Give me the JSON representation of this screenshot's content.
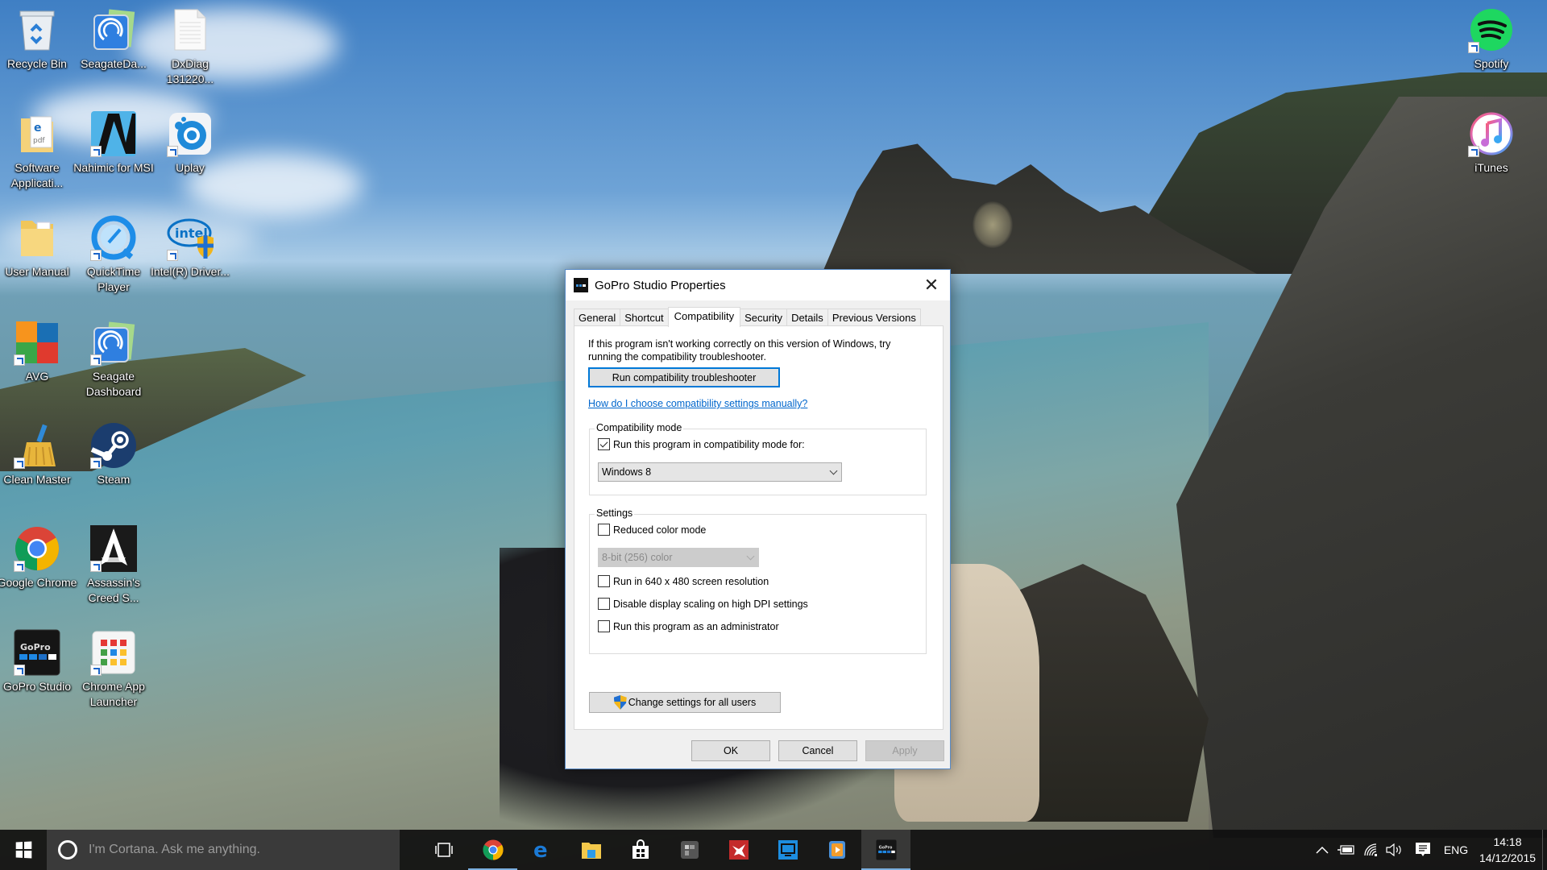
{
  "desktop": {
    "icons": [
      {
        "label": "Recycle Bin",
        "icon": "recycle-bin-icon",
        "shortcut": false
      },
      {
        "label": "SeagateDa...",
        "icon": "seagate-icon",
        "shortcut": false
      },
      {
        "label": "DxDiag 131220...",
        "icon": "text-file-icon",
        "shortcut": false
      },
      {
        "label": "Software Applicati...",
        "icon": "folder-pdf-icon",
        "shortcut": false
      },
      {
        "label": "Nahimic for MSI",
        "icon": "nahimic-icon",
        "shortcut": true
      },
      {
        "label": "Uplay",
        "icon": "uplay-icon",
        "shortcut": true
      },
      {
        "label": "User Manual",
        "icon": "folder-icon",
        "shortcut": false
      },
      {
        "label": "QuickTime Player",
        "icon": "quicktime-icon",
        "shortcut": true
      },
      {
        "label": "Intel(R) Driver...",
        "icon": "intel-icon",
        "shortcut": true
      },
      {
        "label": "AVG",
        "icon": "avg-icon",
        "shortcut": true
      },
      {
        "label": "Seagate Dashboard",
        "icon": "seagate-icon",
        "shortcut": true
      },
      {
        "label": "Clean Master",
        "icon": "broom-icon",
        "shortcut": true
      },
      {
        "label": "Steam",
        "icon": "steam-icon",
        "shortcut": true
      },
      {
        "label": "Google Chrome",
        "icon": "chrome-icon",
        "shortcut": true
      },
      {
        "label": "Assassin's Creed S...",
        "icon": "assassins-creed-icon",
        "shortcut": true
      },
      {
        "label": "GoPro Studio",
        "icon": "gopro-icon",
        "shortcut": true
      },
      {
        "label": "Chrome App Launcher",
        "icon": "app-launcher-icon",
        "shortcut": true
      },
      {
        "label": "Spotify",
        "icon": "spotify-icon",
        "shortcut": true
      },
      {
        "label": "iTunes",
        "icon": "itunes-icon",
        "shortcut": true
      }
    ]
  },
  "dialog": {
    "title": "GoPro Studio Properties",
    "close_glyph": "✕",
    "tabs": [
      {
        "label": "General",
        "active": false
      },
      {
        "label": "Shortcut",
        "active": false
      },
      {
        "label": "Compatibility",
        "active": true
      },
      {
        "label": "Security",
        "active": false
      },
      {
        "label": "Details",
        "active": false
      },
      {
        "label": "Previous Versions",
        "active": false
      }
    ],
    "intro_text": "If this program isn't working correctly on this version of Windows, try running the compatibility troubleshooter.",
    "troubleshooter_button": "Run compatibility troubleshooter",
    "help_link": "How do I choose compatibility settings manually?",
    "compat_group": {
      "title": "Compatibility mode",
      "checkbox_label": "Run this program in compatibility mode for:",
      "checked": true,
      "selected_os": "Windows 8"
    },
    "settings_group": {
      "title": "Settings",
      "reduced_color": {
        "label": "Reduced color mode",
        "checked": false
      },
      "color_select": "8-bit (256) color",
      "options": [
        {
          "label": "Run in 640 x 480 screen resolution",
          "checked": false
        },
        {
          "label": "Disable display scaling on high DPI settings",
          "checked": false
        },
        {
          "label": "Run this program as an administrator",
          "checked": false
        }
      ]
    },
    "all_users_button": "Change settings for all users",
    "ok_button": "OK",
    "cancel_button": "Cancel",
    "apply_button": "Apply"
  },
  "taskbar": {
    "cortana_placeholder": "I'm Cortana. Ask me anything.",
    "pinned": [
      {
        "name": "task-view",
        "running": false,
        "active": false
      },
      {
        "name": "google-chrome",
        "running": true,
        "active": false
      },
      {
        "name": "microsoft-edge",
        "running": false,
        "active": false
      },
      {
        "name": "file-explorer",
        "running": false,
        "active": false
      },
      {
        "name": "windows-store",
        "running": false,
        "active": false
      },
      {
        "name": "msi-app",
        "running": false,
        "active": false
      },
      {
        "name": "msi-dragon-center",
        "running": false,
        "active": false
      },
      {
        "name": "remote-desktop",
        "running": false,
        "active": false
      },
      {
        "name": "media-player",
        "running": false,
        "active": false
      },
      {
        "name": "gopro-studio",
        "running": true,
        "active": true
      }
    ],
    "tray": {
      "language": "ENG",
      "time": "14:18",
      "date": "14/12/2015"
    }
  }
}
